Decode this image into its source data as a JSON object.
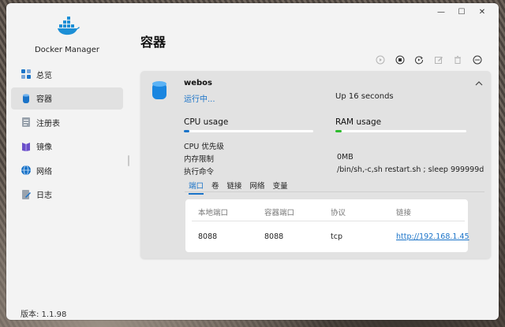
{
  "window": {
    "controls": {
      "minimize": "—",
      "maximize": "☐",
      "close": "✕"
    }
  },
  "app": {
    "name": "Docker Manager",
    "version": "版本: 1.1.98",
    "brand_color": "#1a73c8"
  },
  "sidebar": {
    "items": [
      {
        "label": "总览",
        "icon": "dashboard-icon"
      },
      {
        "label": "容器",
        "icon": "container-icon",
        "active": true
      },
      {
        "label": "注册表",
        "icon": "registry-icon"
      },
      {
        "label": "镜像",
        "icon": "image-icon"
      },
      {
        "label": "网络",
        "icon": "network-icon"
      },
      {
        "label": "日志",
        "icon": "log-icon"
      }
    ]
  },
  "page": {
    "title": "容器"
  },
  "toolbar": {
    "buttons": [
      "start-icon",
      "stop-icon",
      "restart-icon",
      "edit-icon",
      "delete-icon",
      "more-icon"
    ]
  },
  "container": {
    "name": "webos",
    "status": "运行中...",
    "uptime": "Up 16 seconds",
    "cpu": {
      "label": "CPU usage",
      "percent": 4,
      "color": "#1a73c8"
    },
    "ram": {
      "label": "RAM usage",
      "percent": 5,
      "color": "#2dbb2d"
    },
    "info": {
      "cpu_priority_label": "CPU 优先级",
      "cpu_priority_value": "",
      "memory_limit_label": "内存限制",
      "memory_limit_value": "0MB",
      "command_label": "执行命令",
      "command_value": "/bin/sh,-c,sh restart.sh ; sleep 999999d"
    },
    "tabs": [
      "端口",
      "卷",
      "链接",
      "网络",
      "变量"
    ],
    "active_tab": 0,
    "ports": {
      "headers": [
        "本地端口",
        "容器端口",
        "协议",
        "链接"
      ],
      "rows": [
        {
          "local": "8088",
          "container": "8088",
          "protocol": "tcp",
          "link": "http://192.168.1.45"
        }
      ]
    }
  }
}
